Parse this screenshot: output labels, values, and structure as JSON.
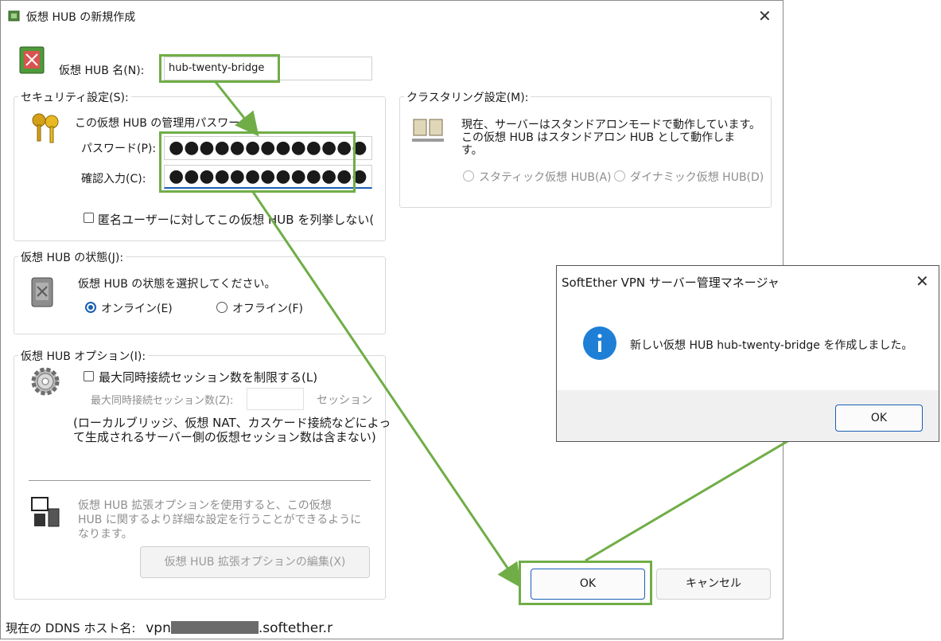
{
  "main_window": {
    "title": "仮想 HUB の新規作成",
    "hub_name_label": "仮想 HUB 名(N):",
    "hub_name_value": "hub-twenty-bridge",
    "security": {
      "legend": "セキュリティ設定(S):",
      "description": "この仮想 HUB の管理用パスワード",
      "password_label": "パスワード(P):",
      "password_value": "●●●●●●●●●●●●●",
      "confirm_label": "確認入力(C):",
      "confirm_value": "●●●●●●●●●●●●●",
      "anonymous_checkbox": "匿名ユーザーに対してこの仮想 HUB を列挙しない("
    },
    "clustering": {
      "legend": "クラスタリング設定(M):",
      "text_line1": "現在、サーバーはスタンドアロンモードで動作しています。",
      "text_line2": "この仮想 HUB はスタンドアロン HUB として動作しま",
      "text_line3": "す。",
      "static_option": "スタティック仮想 HUB(A)",
      "dynamic_option": "ダイナミック仮想 HUB(D)"
    },
    "state": {
      "legend": "仮想 HUB の状態(J):",
      "description": "仮想 HUB の状態を選択してください。",
      "online": "オンライン(E)",
      "offline": "オフライン(F)"
    },
    "options": {
      "legend": "仮想 HUB オプション(I):",
      "limit_checkbox": "最大同時接続セッション数を制限する(L)",
      "max_sessions_label": "最大同時接続セッション数(Z):",
      "sessions_unit": "セッション",
      "note_line1": "(ローカルブリッジ、仮想 NAT、カスケード接続などによっ",
      "note_line2": "て生成されるサーバー側の仮想セッション数は含まない)",
      "ext_line1": "仮想 HUB 拡張オプションを使用すると、この仮想",
      "ext_line2": "HUB に関するより詳細な設定を行うことができるように",
      "ext_line3": "なります。",
      "ext_button": "仮想 HUB 拡張オプションの編集(X)"
    },
    "ok_button": "OK",
    "cancel_button": "キャンセル",
    "status_prefix": "現在の DDNS ホスト名:",
    "status_host_start": "vpn",
    "status_host_end": ".softether.r"
  },
  "message_dialog": {
    "title": "SoftEther VPN サーバー管理マネージャ",
    "message": "新しい仮想 HUB hub-twenty-bridge を作成しました。",
    "ok_button": "OK"
  },
  "colors": {
    "highlight_green": "#70ad47",
    "focus_blue": "#1a5fb4",
    "info_blue": "#1f7fd6"
  }
}
